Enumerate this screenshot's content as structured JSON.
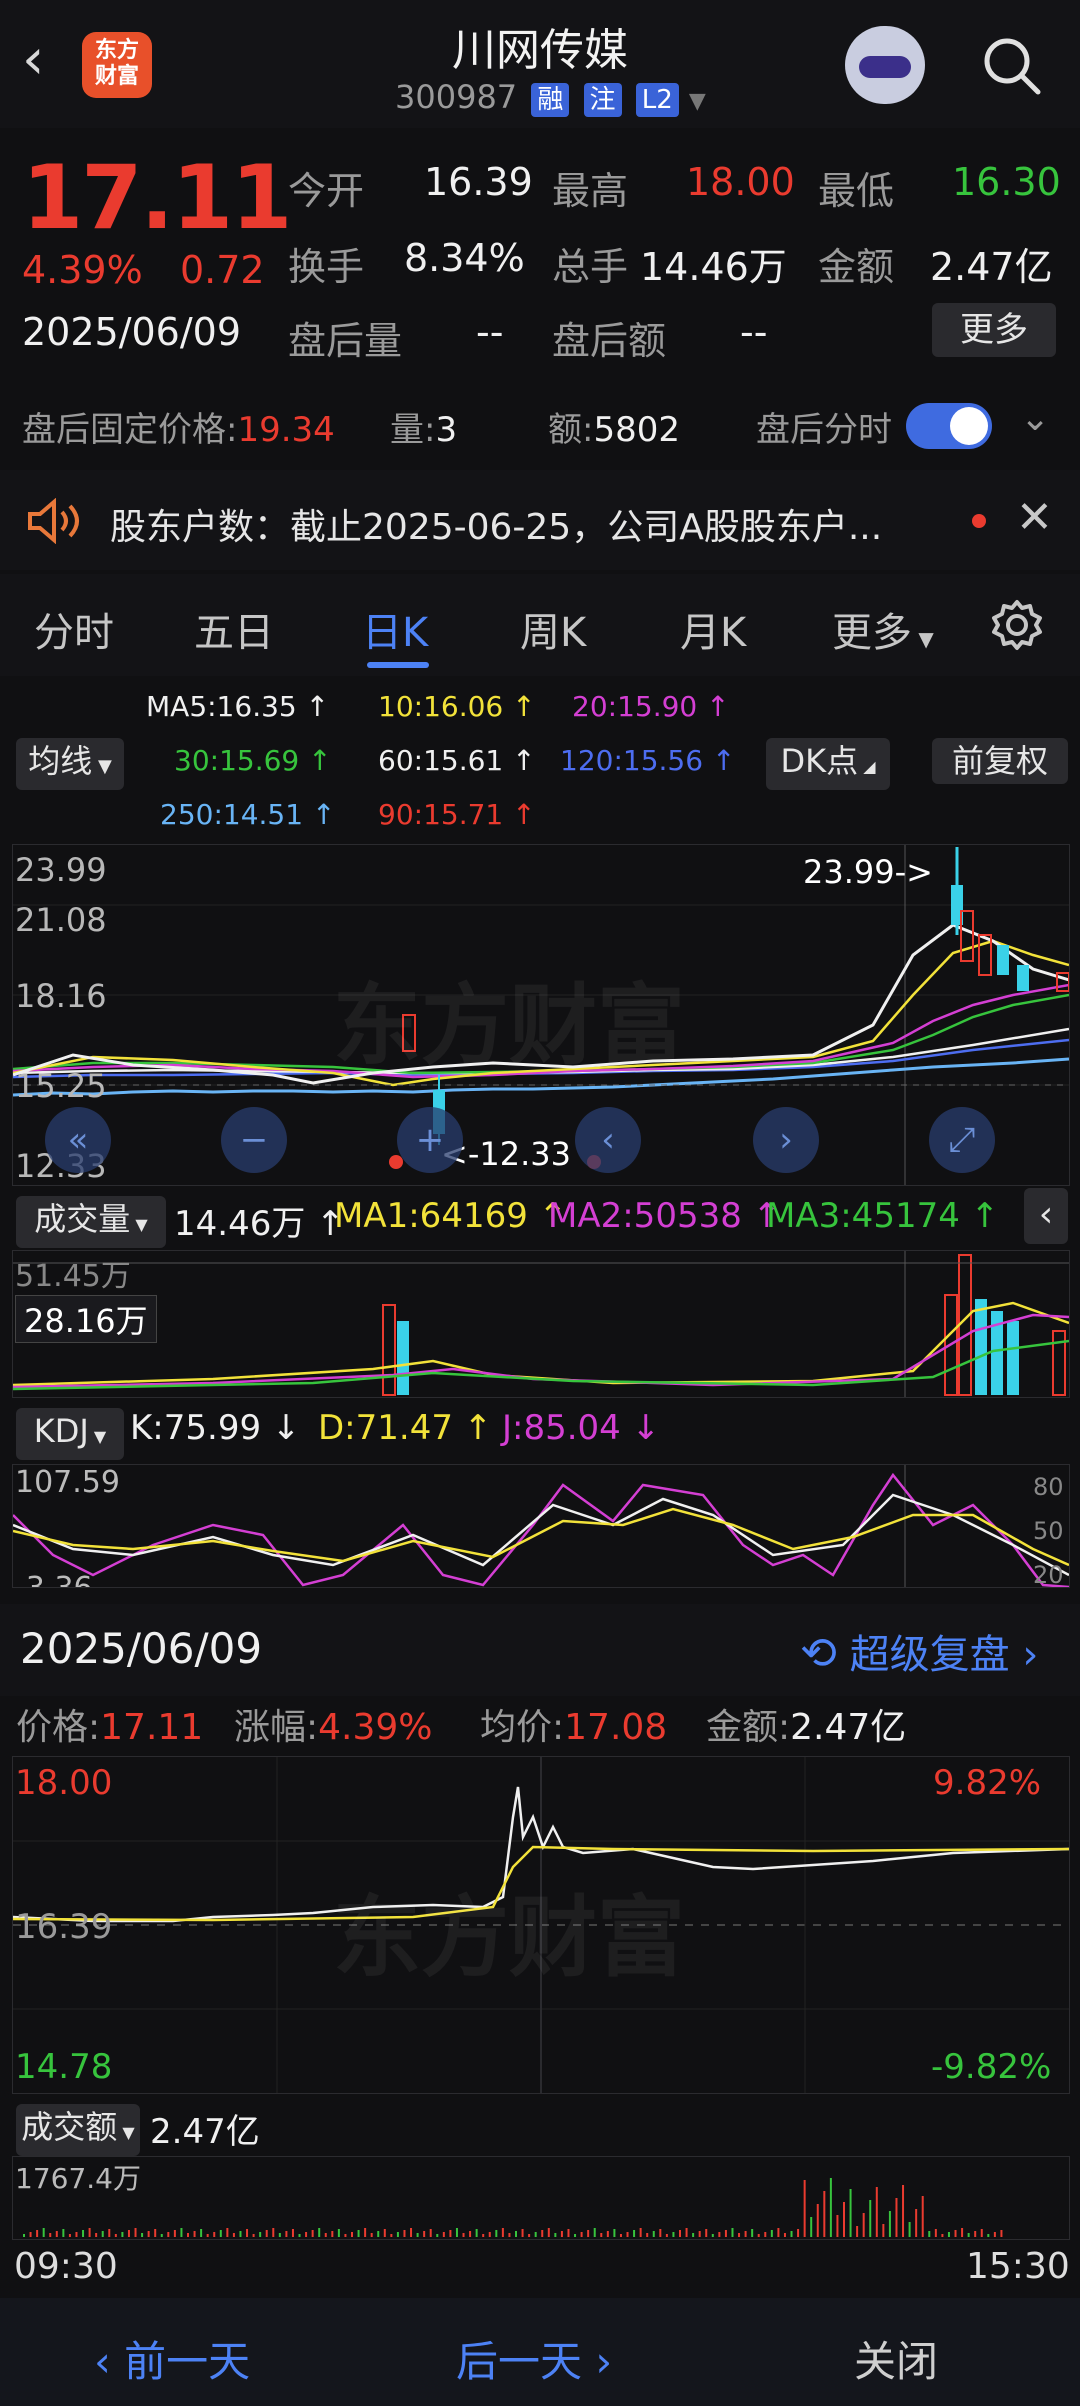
{
  "header": {
    "back_icon": "chevron-left-icon",
    "logo_text": "东方财富",
    "title": "川网传媒",
    "code": "300987",
    "tags": [
      "融",
      "注",
      "L2"
    ]
  },
  "quote": {
    "price": "17.11",
    "change_pct": "4.39%",
    "change": "0.72",
    "date": "2025/06/09",
    "fields": {
      "open_label": "今开",
      "open": "16.39",
      "high_label": "最高",
      "high": "18.00",
      "low_label": "最低",
      "low": "16.30",
      "turnover_label": "换手",
      "turnover": "8.34%",
      "volume_label": "总手",
      "volume": "14.46万",
      "amount_label": "金额",
      "amount": "2.47亿",
      "ah_vol_label": "盘后量",
      "ah_vol": "--",
      "ah_amt_label": "盘后额",
      "ah_amt": "--"
    },
    "more_button": "更多",
    "after_hours": {
      "price_label": "盘后固定价格:",
      "price": "19.34",
      "vol_label": "量:",
      "vol": "3",
      "amt_label": "额:",
      "amt": "5802",
      "toggle_label": "盘后分时"
    }
  },
  "notice": {
    "text": "股东户数：截止2025-06-25，公司A股股东户..."
  },
  "tabs": [
    "分时",
    "五日",
    "日K",
    "周K",
    "月K",
    "更多"
  ],
  "ma_legend": {
    "ma5": "MA5:16.35",
    "ma10": "10:16.06",
    "ma20": "20:15.90",
    "ma30": "30:15.69",
    "ma60": "60:15.61",
    "ma120": "120:15.56",
    "ma250": "250:14.51",
    "ma90": "90:15.71",
    "avg_button": "均线",
    "dk_button": "DK点",
    "adjust_button": "前复权"
  },
  "kline": {
    "axis_labels": [
      "23.99",
      "21.08",
      "18.16",
      "15.25",
      "12.33"
    ],
    "max_marker": "23.99->",
    "min_marker": "<-12.33",
    "watermark": "东方财富"
  },
  "volume_panel": {
    "label": "成交量",
    "value": "14.46万",
    "ma1": "MA1:64169",
    "ma2": "MA2:50538",
    "ma3": "MA3:45174",
    "top": "51.45万",
    "cursor": "28.16万"
  },
  "kdj_panel": {
    "label": "KDJ",
    "k": "K:75.99",
    "d": "D:71.47",
    "j": "J:85.04",
    "top": "107.59",
    "bottom": "-3.36",
    "r80": "80",
    "r50": "50",
    "r20": "20"
  },
  "detail": {
    "date": "2025/06/09",
    "replay": "超级复盘",
    "price_label": "价格:",
    "price": "17.11",
    "chg_label": "涨幅:",
    "chg": "4.39%",
    "avg_label": "均价:",
    "avg": "17.08",
    "amt_label": "金额:",
    "amt": "2.47亿"
  },
  "intraday": {
    "high": "18.00",
    "mid": "16.39",
    "low": "14.78",
    "pct_high": "9.82%",
    "pct_low": "-9.82%",
    "watermark": "东方财富"
  },
  "amount_panel": {
    "label": "成交额",
    "value": "2.47亿",
    "top": "1767.4万",
    "start_time": "09:30",
    "end_time": "15:30"
  },
  "footer": {
    "prev": "前一天",
    "next": "后一天",
    "close": "关闭"
  },
  "colors": {
    "up": "#ea3b2f",
    "down": "#37c43d",
    "accent": "#4d82f5"
  }
}
